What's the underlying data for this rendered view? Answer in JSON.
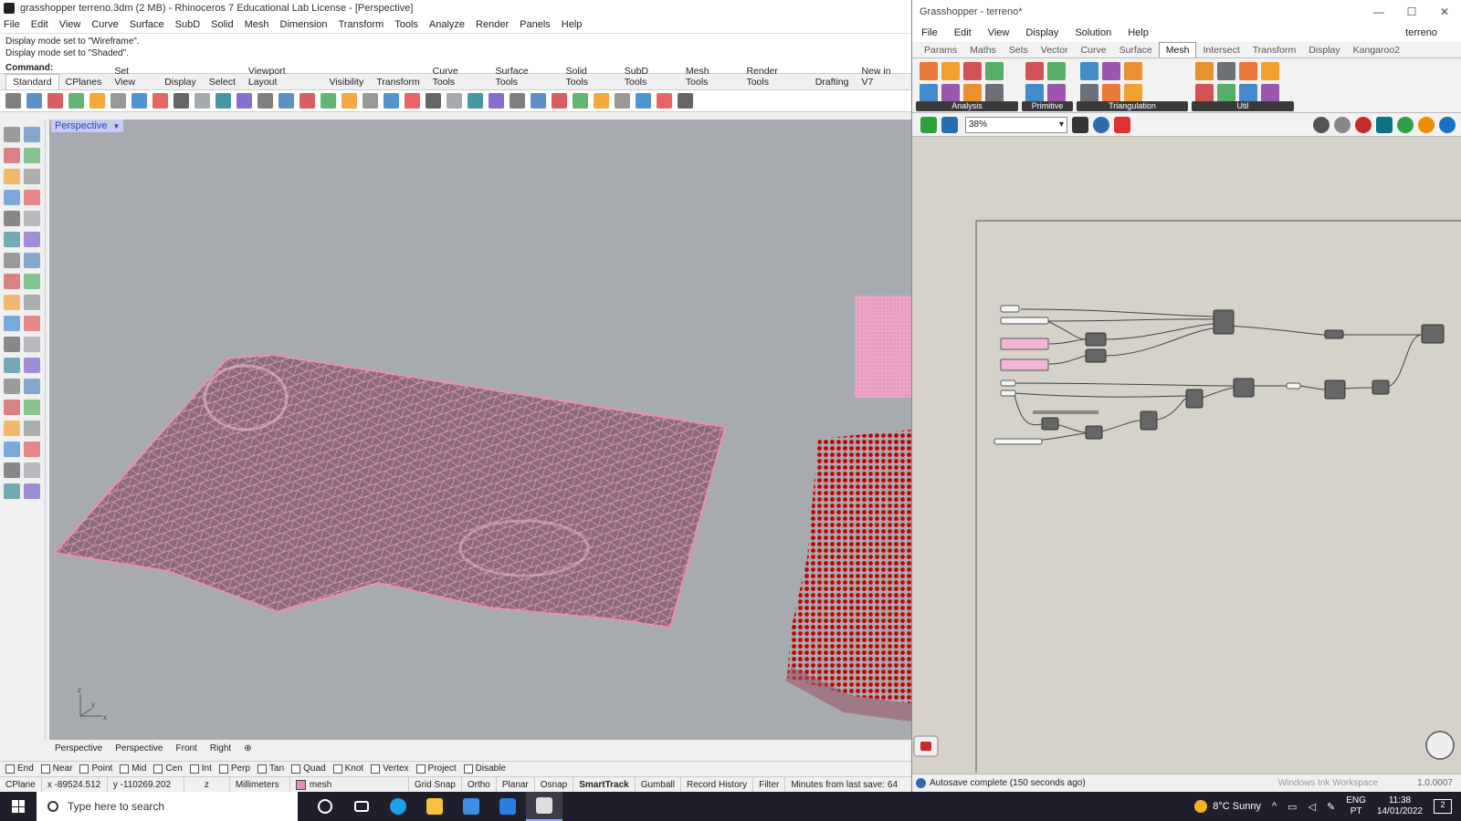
{
  "rhino": {
    "title": "grasshopper terreno.3dm (2 MB) - Rhinoceros 7 Educational Lab License - [Perspective]",
    "menu": [
      "File",
      "Edit",
      "View",
      "Curve",
      "Surface",
      "SubD",
      "Solid",
      "Mesh",
      "Dimension",
      "Transform",
      "Tools",
      "Analyze",
      "Render",
      "Panels",
      "Help"
    ],
    "history": [
      "Display mode set to \"Wireframe\".",
      "Display mode set to \"Shaded\"."
    ],
    "command_label": "Command:",
    "tabs": [
      "Standard",
      "CPlanes",
      "Set View",
      "Display",
      "Select",
      "Viewport Layout",
      "Visibility",
      "Transform",
      "Curve Tools",
      "Surface Tools",
      "Solid Tools",
      "SubD Tools",
      "Mesh Tools",
      "Render Tools",
      "Drafting",
      "New in V7"
    ],
    "viewport_label": "Perspective",
    "axis_y": "y",
    "axis_z": "z",
    "axis_x": "x",
    "viewport_tabs": [
      "Perspective",
      "Perspective",
      "Front",
      "Right"
    ],
    "osnaps": [
      {
        "label": "End"
      },
      {
        "label": "Near"
      },
      {
        "label": "Point"
      },
      {
        "label": "Mid"
      },
      {
        "label": "Cen"
      },
      {
        "label": "Int"
      },
      {
        "label": "Perp"
      },
      {
        "label": "Tan"
      },
      {
        "label": "Quad"
      },
      {
        "label": "Knot"
      },
      {
        "label": "Vertex"
      },
      {
        "label": "Project"
      },
      {
        "label": "Disable"
      }
    ],
    "status": {
      "cplane": "CPlane",
      "x": "x -89524.512",
      "y": "y -110269.202",
      "z": "z",
      "units": "Millimeters",
      "layer": "mesh",
      "grid_snap": "Grid Snap",
      "ortho": "Ortho",
      "planar": "Planar",
      "osnap": "Osnap",
      "smarttrack": "SmartTrack",
      "gumball": "Gumball",
      "record_history": "Record History",
      "filter": "Filter",
      "minutes": "Minutes from last save: 64"
    },
    "layer_color": "#e58fb5"
  },
  "grasshopper": {
    "title": "Grasshopper - terreno*",
    "menu": [
      "File",
      "Edit",
      "View",
      "Display",
      "Solution",
      "Help"
    ],
    "doc_name": "terreno",
    "tabs": [
      "Params",
      "Maths",
      "Sets",
      "Vector",
      "Curve",
      "Surface",
      "Mesh",
      "Intersect",
      "Transform",
      "Display",
      "Kangaroo2"
    ],
    "active_tab": "Mesh",
    "groups": [
      "Analysis",
      "Primitive",
      "Triangulation",
      "Util"
    ],
    "zoom": "38%",
    "status_text": "Autosave complete (150 seconds ago)",
    "ink_text": "Windows Ink Workspace",
    "version": "1.0.0007"
  },
  "taskbar": {
    "search_placeholder": "Type here to search",
    "weather": "8°C  Sunny",
    "lang_top": "ENG",
    "lang_bottom": "PT",
    "time": "11:38",
    "date": "14/01/2022",
    "notifications": "2"
  }
}
